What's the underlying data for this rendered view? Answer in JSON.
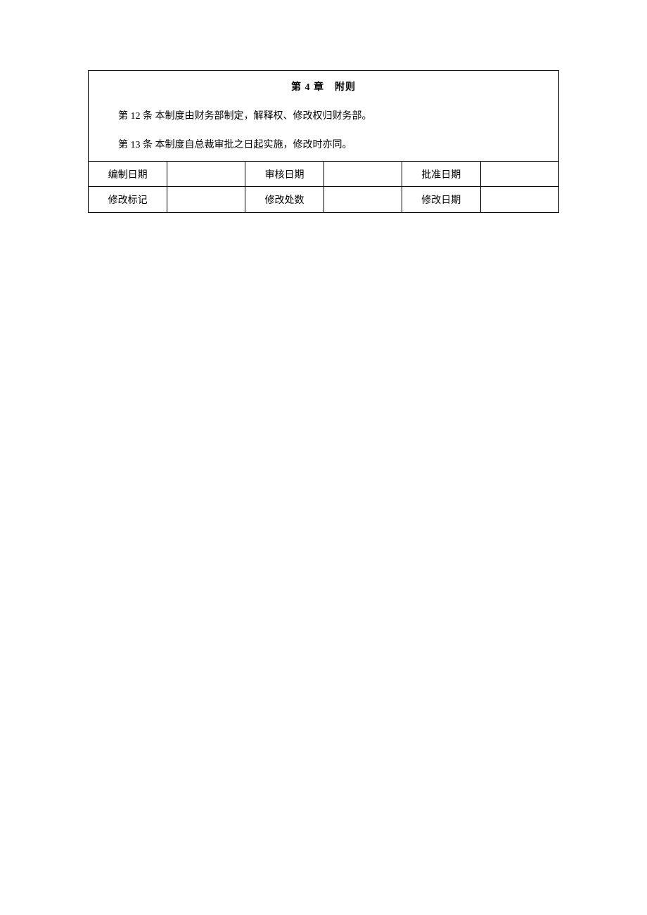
{
  "chapter": {
    "title": "第 4 章　附则"
  },
  "articles": {
    "a12": "第 12 条 本制度由财务部制定，解释权、修改权归财务部。",
    "a13": "第 13 条 本制度自总裁审批之日起实施，修改时亦同。"
  },
  "footer": {
    "row1": {
      "label1": "编制日期",
      "value1": "",
      "label2": "审核日期",
      "value2": "",
      "label3": "批准日期",
      "value3": ""
    },
    "row2": {
      "label1": "修改标记",
      "value1": "",
      "label2": "修改处数",
      "value2": "",
      "label3": "修改日期",
      "value3": ""
    }
  }
}
